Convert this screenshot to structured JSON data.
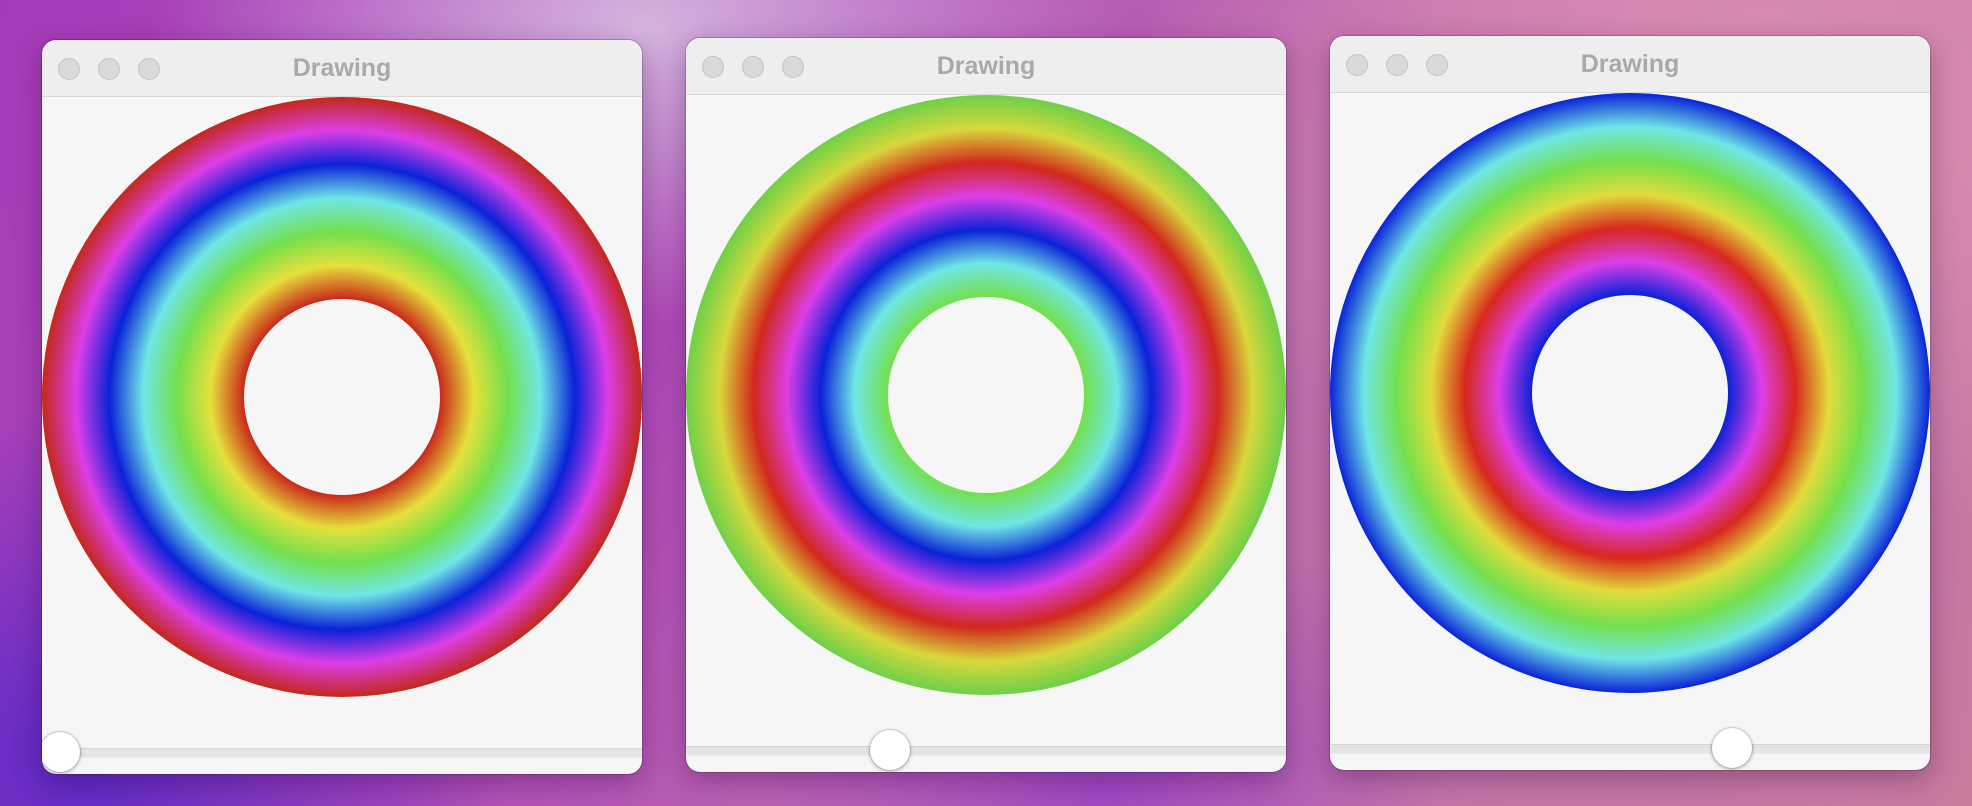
{
  "windows": [
    {
      "title": "Drawing",
      "slider_fraction": 0.03,
      "ring_stops": [
        "#c9281a",
        "#e6e03c",
        "#74e04c",
        "#6fe6e6",
        "#0a22d8",
        "#dc3ee8",
        "#c4281a"
      ],
      "ring_edge_colors": [
        "#c02418",
        "#a81f18"
      ]
    },
    {
      "title": "Drawing",
      "slider_fraction": 0.34,
      "ring_stops": [
        "#74e04c",
        "#6fe6e6",
        "#0a22d8",
        "#dc3ee8",
        "#d2281c",
        "#d8d83c",
        "#6ed048"
      ],
      "ring_edge_colors": [
        "#78ec50",
        "#5ea83c"
      ]
    },
    {
      "title": "Drawing",
      "slider_fraction": 0.67,
      "ring_stops": [
        "#0a22d8",
        "#dc3ee8",
        "#d8281c",
        "#e2dc3c",
        "#74e04c",
        "#6fe6e6",
        "#0a22d8"
      ],
      "ring_edge_colors": [
        "#2a1ee8",
        "#0d18a8"
      ]
    }
  ],
  "icons": {
    "close": "close-icon",
    "minimize": "minimize-icon",
    "zoom": "zoom-icon"
  }
}
